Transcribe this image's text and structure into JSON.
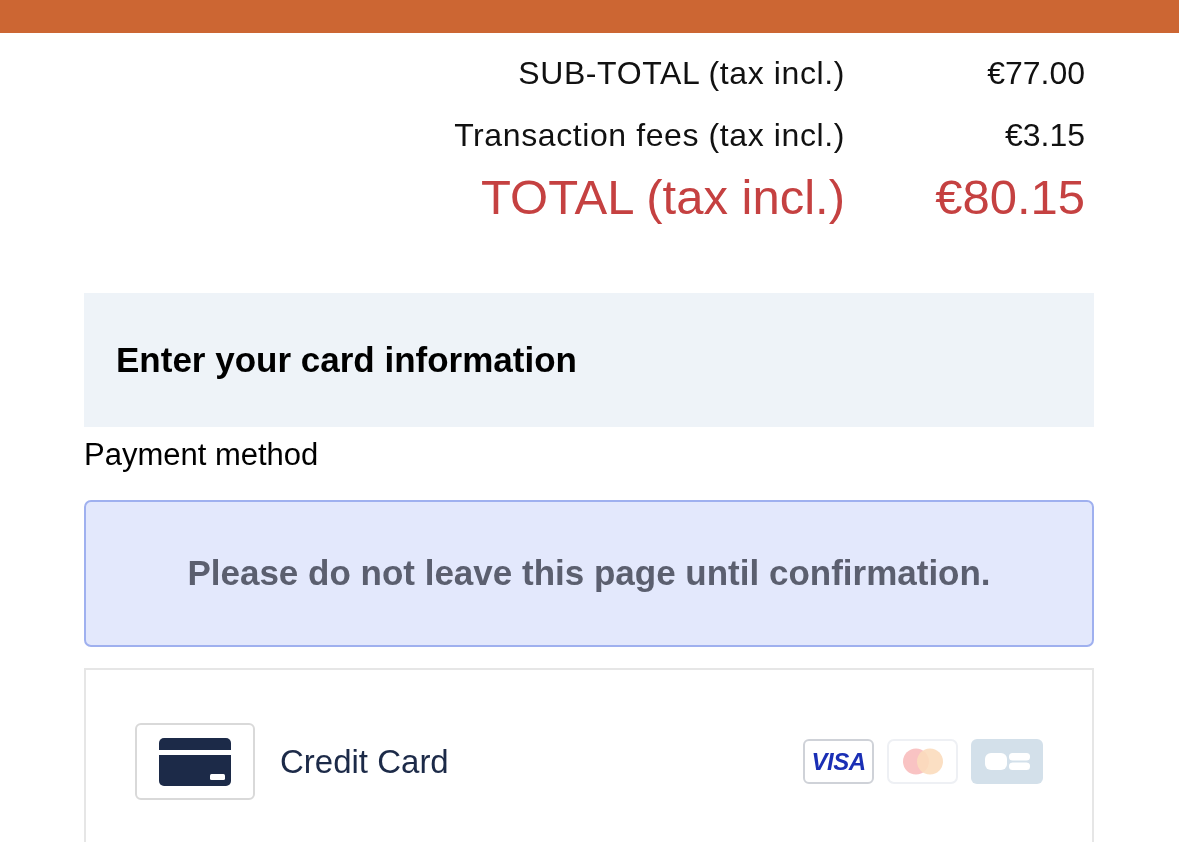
{
  "totals": [
    {
      "kind": "line",
      "label": "SUB-TOTAL (tax incl.)",
      "value": "€77.00"
    },
    {
      "kind": "line",
      "label": "Transaction fees (tax incl.)",
      "value": "€3.15"
    },
    {
      "kind": "total",
      "label": "TOTAL (tax incl.)",
      "value": "€80.15"
    }
  ],
  "section": {
    "title": "Enter your card information"
  },
  "payment_method": {
    "label": "Payment method"
  },
  "notice": "Please do not leave this page until confirmation.",
  "methods": [
    {
      "label": "Credit Card",
      "brands": [
        {
          "kind": "visa",
          "label": "VISA",
          "active": true
        },
        {
          "kind": "mastercard",
          "active": false
        },
        {
          "kind": "cb",
          "active": false
        }
      ]
    }
  ]
}
